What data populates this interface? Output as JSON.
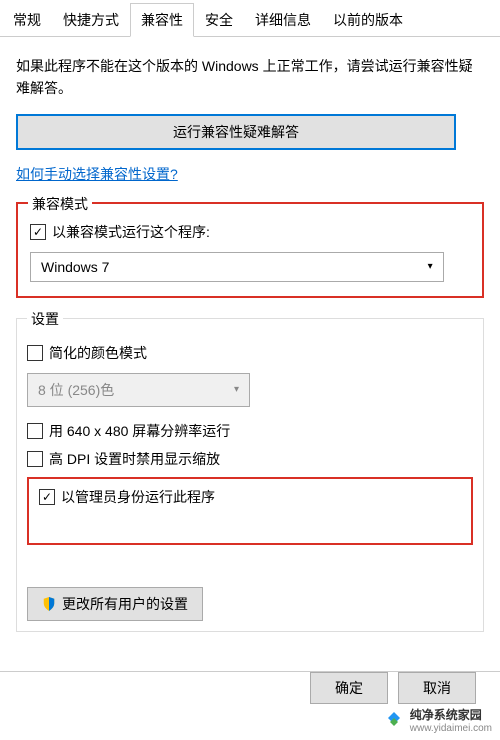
{
  "tabs": {
    "general": "常规",
    "shortcut": "快捷方式",
    "compatibility": "兼容性",
    "security": "安全",
    "details": "详细信息",
    "previous": "以前的版本"
  },
  "intro": "如果此程序不能在这个版本的 Windows 上正常工作，请尝试运行兼容性疑难解答。",
  "troubleshoot_btn": "运行兼容性疑难解答",
  "manual_link": "如何手动选择兼容性设置?",
  "compat_mode": {
    "title": "兼容模式",
    "checkbox_label": "以兼容模式运行这个程序:",
    "select_value": "Windows 7"
  },
  "settings": {
    "title": "设置",
    "reduced_color": "简化的颜色模式",
    "color_select": "8 位 (256)色",
    "res_640": "用 640 x 480 屏幕分辨率运行",
    "high_dpi": "高 DPI 设置时禁用显示缩放",
    "run_admin": "以管理员身份运行此程序"
  },
  "all_users_btn": "更改所有用户的设置",
  "buttons": {
    "ok": "确定",
    "cancel": "取消"
  },
  "watermark": {
    "name": "纯净系统家园",
    "url": "www.yidaimei.com"
  }
}
